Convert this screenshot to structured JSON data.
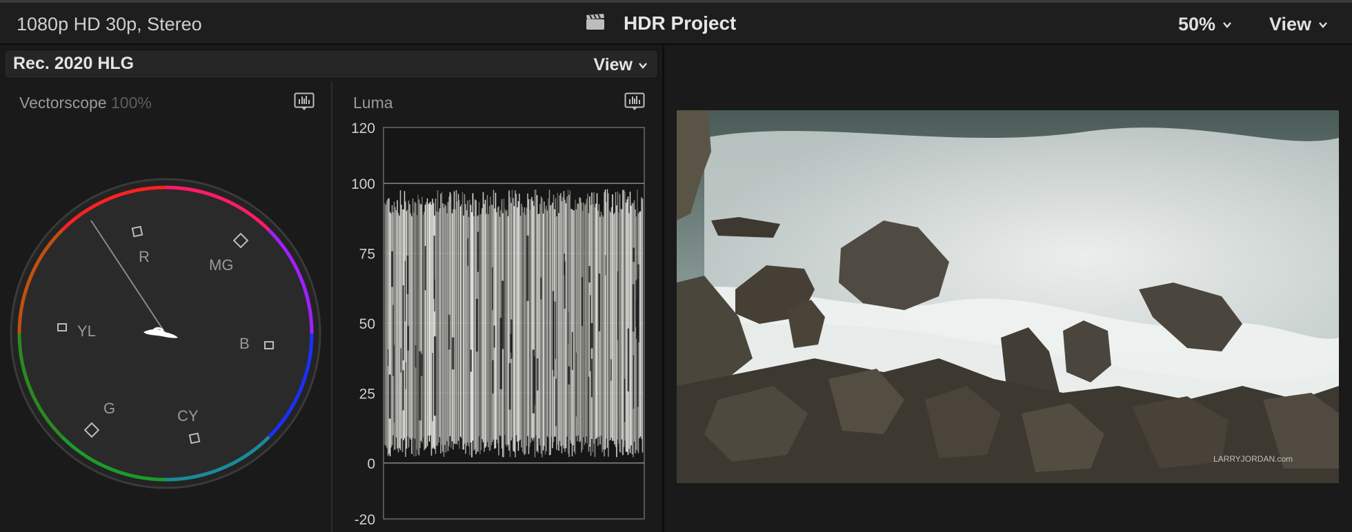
{
  "topbar": {
    "format": "1080p HD 30p, Stereo",
    "project_title": "HDR Project",
    "zoom": "50%",
    "view_label": "View"
  },
  "scopes": {
    "colorspace": "Rec. 2020 HLG",
    "view_label": "View",
    "vectorscope": {
      "title": "Vectorscope",
      "percent": "100%",
      "targets": [
        "R",
        "MG",
        "B",
        "CY",
        "G",
        "YL"
      ]
    },
    "luma": {
      "title": "Luma",
      "scale": [
        "120",
        "100",
        "75",
        "50",
        "25",
        "0",
        "-20"
      ]
    }
  },
  "viewer": {
    "watermark": "LARRYJORDAN.com"
  },
  "colors": {
    "background": "#1a1a1a",
    "panel_header": "#262626",
    "text": "#d8d8d8"
  }
}
